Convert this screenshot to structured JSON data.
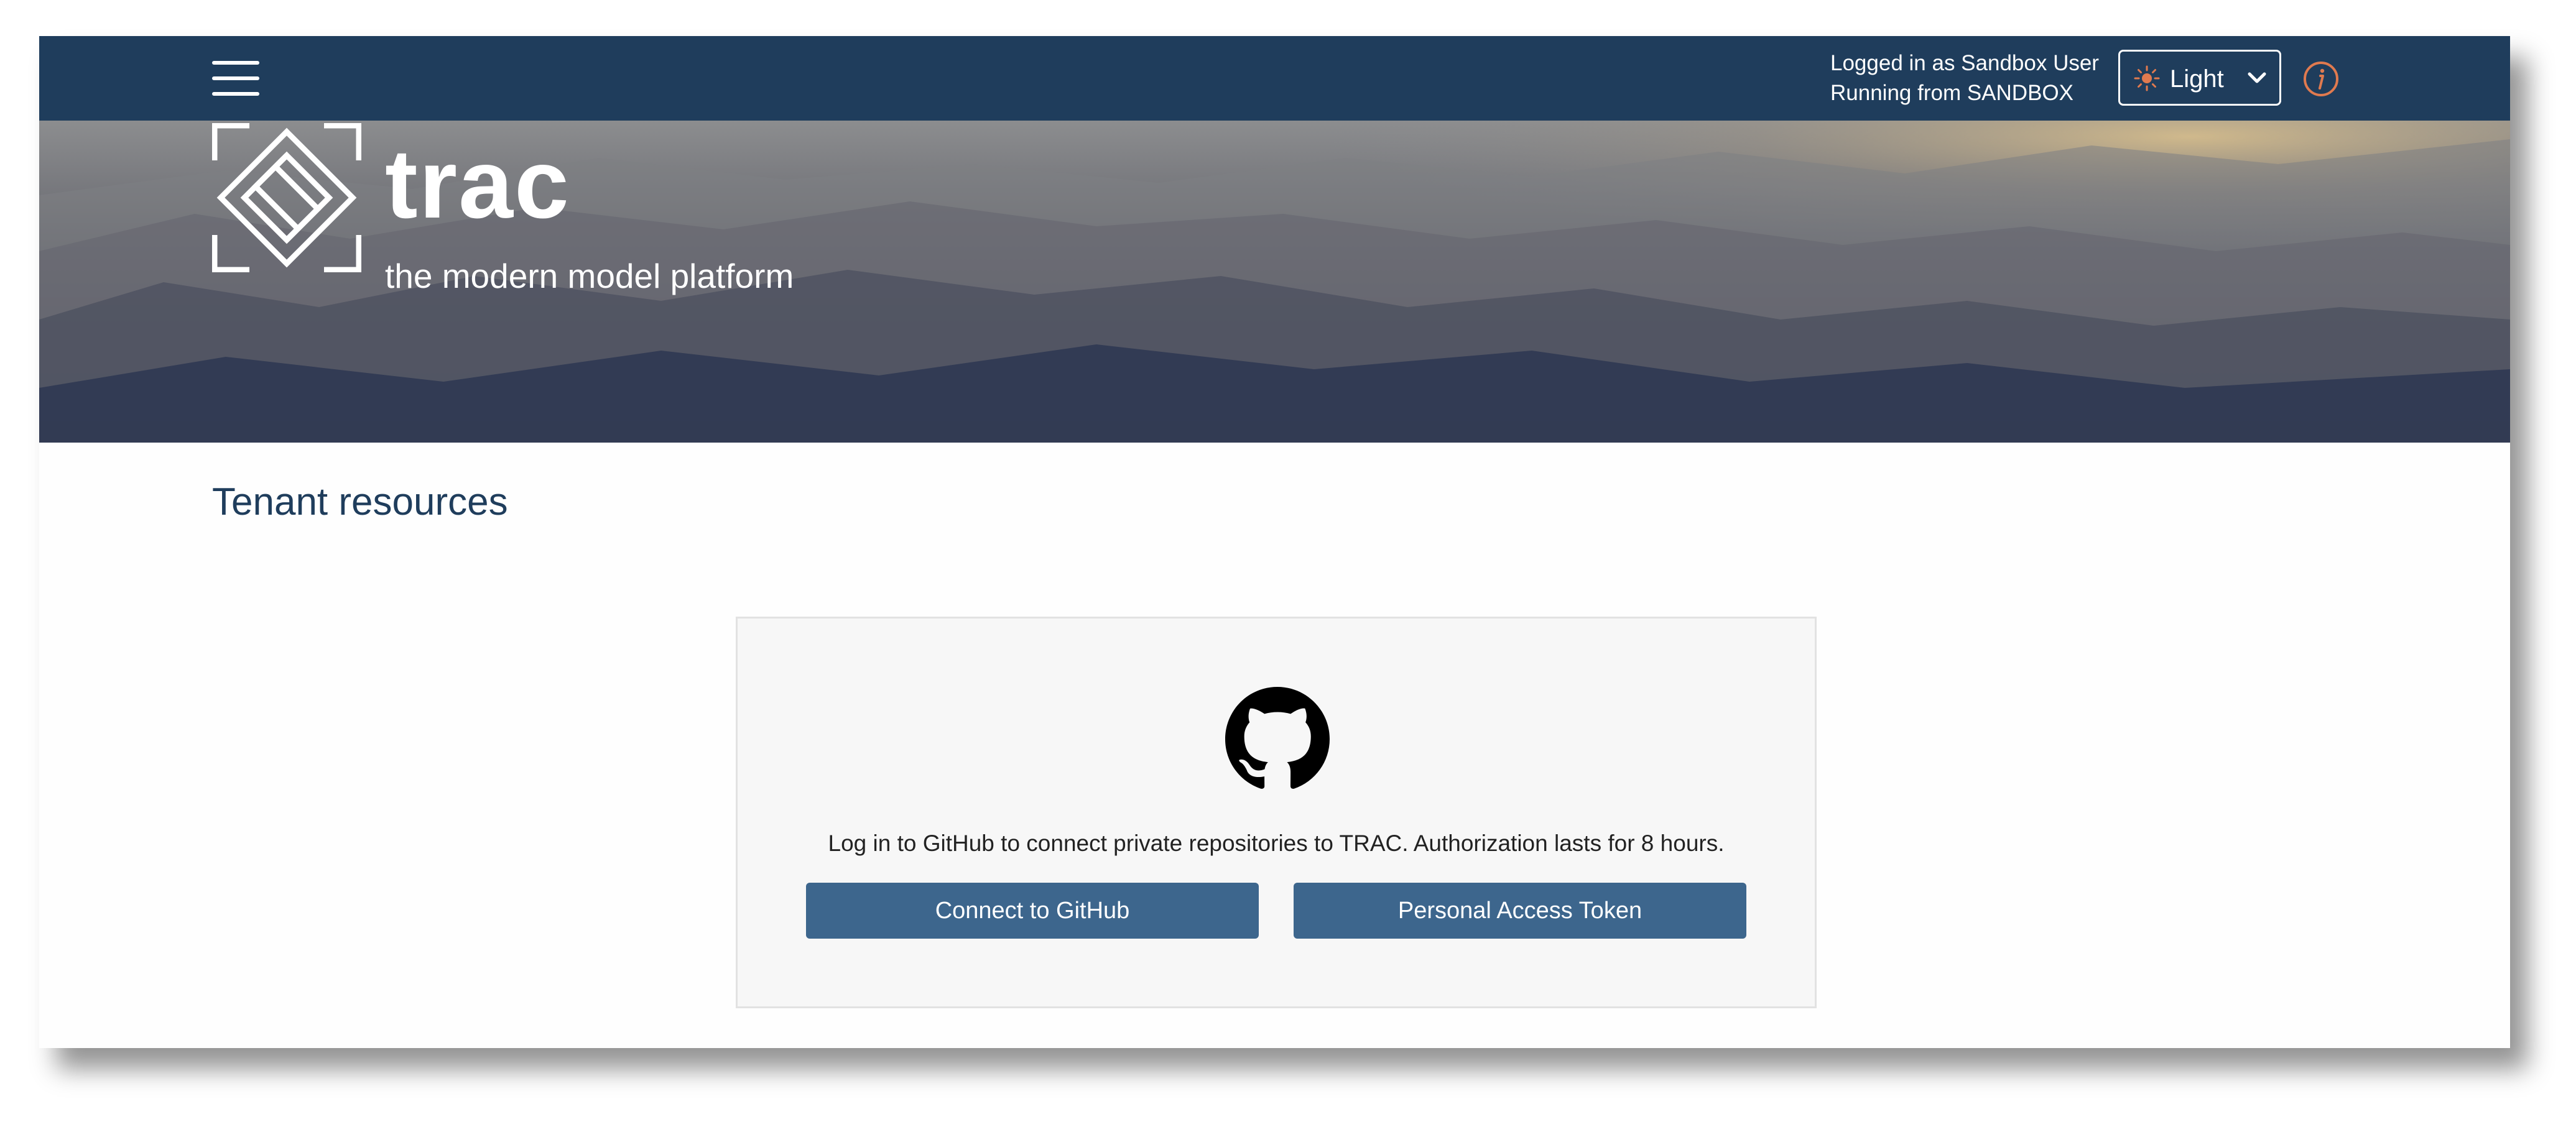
{
  "header": {
    "logged_in_text": "Logged in as Sandbox User",
    "running_text": "Running from SANDBOX",
    "theme": {
      "selected": "Light",
      "icon": "sun-icon"
    },
    "info_icon": "info-icon",
    "menu_icon": "hamburger-menu-icon"
  },
  "brand": {
    "name": "trac",
    "tagline": "the modern model platform"
  },
  "main": {
    "title": "Tenant resources",
    "github_card": {
      "icon": "github-icon",
      "message": "Log in to GitHub to connect private repositories to TRAC. Authorization lasts for 8 hours.",
      "connect_label": "Connect to GitHub",
      "token_label": "Personal Access Token"
    }
  },
  "colors": {
    "navbar": "#1f3d5c",
    "button": "#3d668d",
    "accent_icon": "#e07a4f",
    "title": "#1f3d5c"
  }
}
